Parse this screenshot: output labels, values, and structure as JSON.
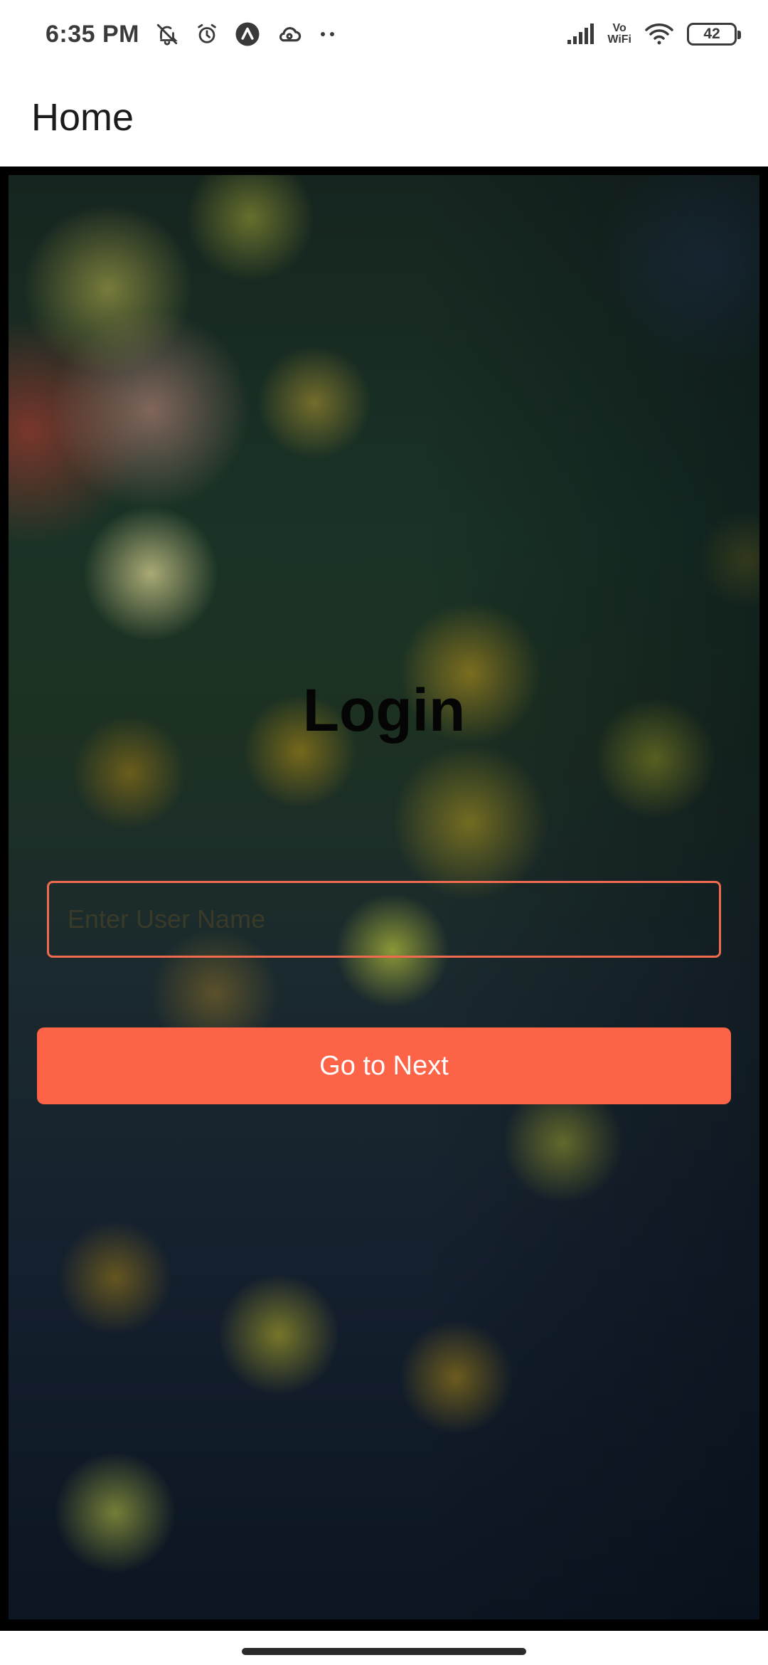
{
  "status_bar": {
    "time": "6:35 PM",
    "icons": [
      "bell-off-icon",
      "alarm-icon",
      "app-icon",
      "cloud-icon",
      "more-dots-icon"
    ],
    "network_icons": [
      "signal-icon",
      "vowifi-icon",
      "wifi-icon"
    ],
    "vowifi_top": "Vo",
    "vowifi_bottom": "WiFi",
    "battery": "42"
  },
  "app_bar": {
    "title": "Home"
  },
  "login": {
    "title": "Login",
    "username_placeholder": "Enter User Name",
    "username_value": "",
    "next_button_label": "Go to Next"
  },
  "colors": {
    "accent": "#fd6347",
    "input_border": "#f06a4f",
    "title_text": "#050505"
  }
}
